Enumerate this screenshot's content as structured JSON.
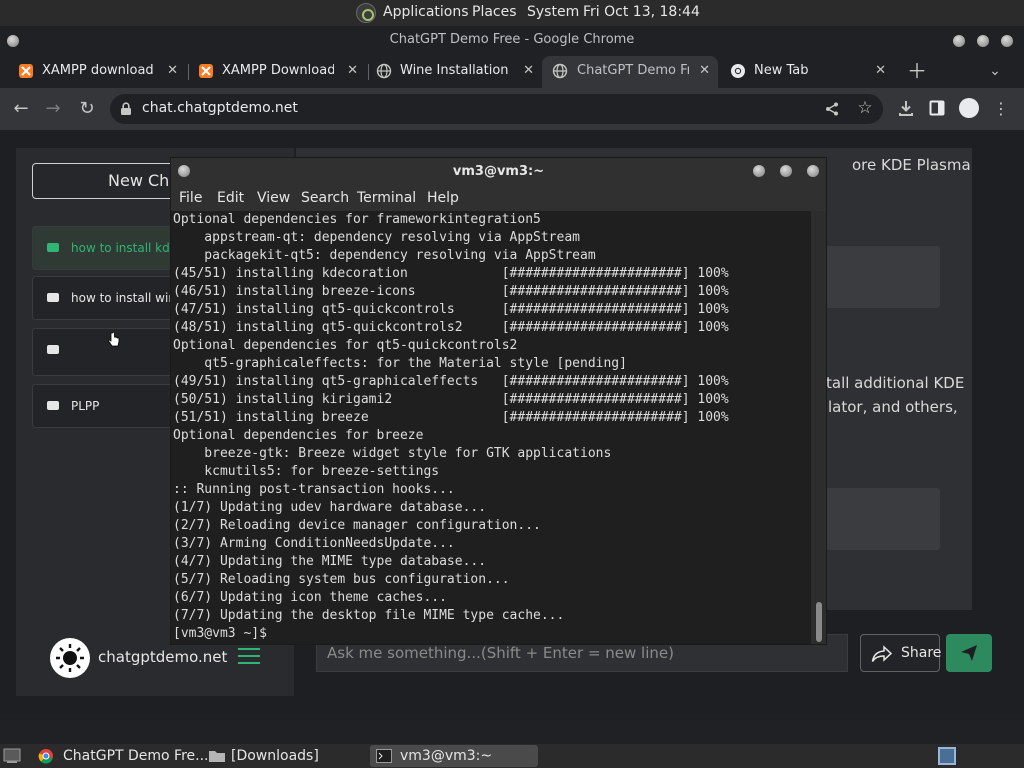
{
  "top_panel": {
    "applications": "Applications",
    "places": "Places",
    "system": "System",
    "clock": "Fri Oct 13, 18:44"
  },
  "chrome": {
    "window_title": "ChatGPT Demo Free - Google Chrome",
    "tabs": [
      {
        "title": "XAMPP download |",
        "icon": "xampp-icon"
      },
      {
        "title": "XAMPP Download",
        "icon": "xampp-icon"
      },
      {
        "title": "Wine Installation a",
        "icon": "globe-icon"
      },
      {
        "title": "ChatGPT Demo Fre",
        "icon": "globe-icon"
      },
      {
        "title": "New Tab",
        "icon": "chrome-icon"
      }
    ],
    "url": "chat.chatgptdemo.net"
  },
  "sidebar": {
    "new_chat": "New Cha",
    "items": [
      {
        "label": "how to install kde"
      },
      {
        "label": "how to install wine"
      },
      {
        "label": ""
      },
      {
        "label": "PLPP"
      }
    ],
    "footer_domain": "chatgptdemo.net"
  },
  "main": {
    "text_top": "ore KDE Plasma",
    "text_mid_1": "tall additional KDE",
    "text_mid_2": "lator, and others,",
    "input_placeholder": "Ask me something...(Shift + Enter = new line)",
    "share_label": "Share"
  },
  "terminal": {
    "title": "vm3@vm3:~",
    "menu": [
      "File",
      "Edit",
      "View",
      "Search",
      "Terminal",
      "Help"
    ],
    "lines": [
      "Optional dependencies for frameworkintegration5",
      "    appstream-qt: dependency resolving via AppStream",
      "    packagekit-qt5: dependency resolving via AppStream",
      "(45/51) installing kdecoration            [######################] 100%",
      "(46/51) installing breeze-icons           [######################] 100%",
      "(47/51) installing qt5-quickcontrols      [######################] 100%",
      "(48/51) installing qt5-quickcontrols2     [######################] 100%",
      "Optional dependencies for qt5-quickcontrols2",
      "    qt5-graphicaleffects: for the Material style [pending]",
      "(49/51) installing qt5-graphicaleffects   [######################] 100%",
      "(50/51) installing kirigami2              [######################] 100%",
      "(51/51) installing breeze                 [######################] 100%",
      "Optional dependencies for breeze",
      "    breeze-gtk: Breeze widget style for GTK applications",
      "    kcmutils5: for breeze-settings",
      ":: Running post-transaction hooks...",
      "(1/7) Updating udev hardware database...",
      "(2/7) Reloading device manager configuration...",
      "(3/7) Arming ConditionNeedsUpdate...",
      "(4/7) Updating the MIME type database...",
      "(5/7) Reloading system bus configuration...",
      "(6/7) Updating icon theme caches...",
      "(7/7) Updating the desktop file MIME type cache...",
      "[vm3@vm3 ~]$"
    ]
  },
  "taskbar": {
    "items": [
      {
        "label": "ChatGPT Demo Fre...",
        "icon": "chrome-icon"
      },
      {
        "label": "[Downloads]",
        "icon": "folder-icon"
      },
      {
        "label": "vm3@vm3:~",
        "icon": "terminal-icon"
      }
    ]
  },
  "colors": {
    "accent_green": "#2fb574",
    "send_button": "#2d8a5e",
    "terminal_bg": "#1f1f1f"
  }
}
